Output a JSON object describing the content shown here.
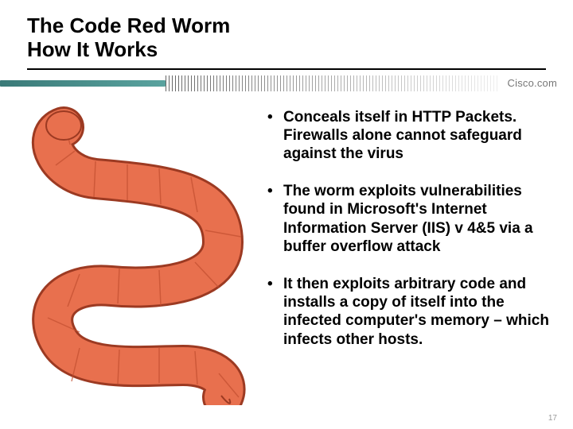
{
  "title": {
    "line1": "The Code Red Worm",
    "line2": "How It Works"
  },
  "brand": "Cisco.com",
  "bullets": [
    "Conceals itself in HTTP Packets. Firewalls alone cannot safeguard against the virus",
    "The worm exploits vulnerabilities found in Microsoft's Internet Information Server (IIS) v 4&5 via a buffer overflow attack",
    "It then exploits arbitrary code and installs a copy of itself into the infected computer's memory – which infects other hosts."
  ],
  "page_number": "17",
  "illustration": {
    "name": "worm-illustration",
    "fill": "#e8704e",
    "stroke": "#9c3a22"
  }
}
